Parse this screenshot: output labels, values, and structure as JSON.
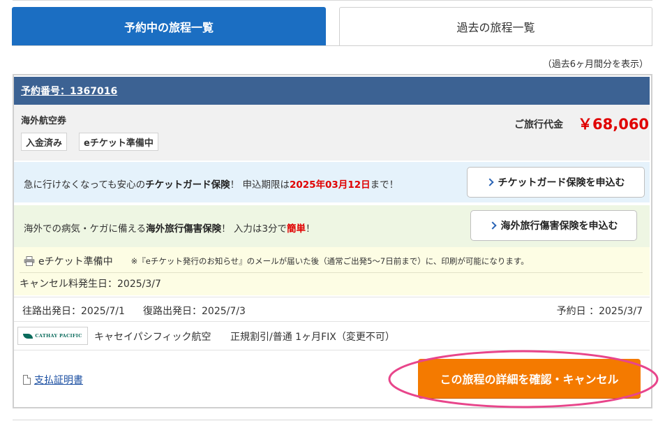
{
  "tabs": {
    "upcoming": "予約中の旅程一覧",
    "past": "過去の旅程一覧"
  },
  "period_note": "（過去6ヶ月間分を表示）",
  "reservation": {
    "number_label": "予約番号：1367016",
    "product_type": "海外航空券",
    "badges": [
      "入金済み",
      "eチケット準備中"
    ],
    "price_label": "ご旅行代金",
    "price_value": "￥68,060"
  },
  "ticket_guard": {
    "text_1": "急に行けなくなっても安心の",
    "text_bold": "チケットガード保険",
    "text_2": "！ 申込期限は",
    "deadline": "2025年03月12日",
    "text_3": "まで！",
    "button_label": "チケットガード保険を申込む"
  },
  "travel_insurance": {
    "text_1": "海外での病気・ケガに備える",
    "text_bold": "海外旅行傷害保険",
    "text_2": "！ 入力は3分で",
    "text_red": "簡単",
    "text_3": "！",
    "button_label": "海外旅行傷害保険を申込む"
  },
  "eticket": {
    "status": "eチケット準備中",
    "note": "※『eチケット発行のお知らせ』のメールが届いた後（通常ご出発5〜7日前まで）に、印刷が可能になります。",
    "cancel_fee_date": "キャンセル料発生日：2025/3/7"
  },
  "dates": {
    "outbound": "往路出発日：2025/7/1",
    "return": "復路出発日：2025/7/3",
    "booked": "予約日 ：2025/3/7"
  },
  "flight": {
    "logo_text": "CATHAY PACIFIC",
    "airline": "キャセイパシフィック航空",
    "fare": "正規割引/普通 1ヶ月FIX（変更不可）"
  },
  "footer": {
    "receipt_label": "支払証明書",
    "details_button": "この旅程の詳細を確認・キャンセル"
  },
  "colors": {
    "tab_active": "#1b6ec2",
    "header": "#3c6293",
    "price": "#e00000",
    "details_button": "#f47a00",
    "highlight_ring": "#e8458b"
  },
  "icons": [
    "printer-icon",
    "document-icon",
    "chevron-right-icon",
    "cathay-pacific-logo"
  ]
}
